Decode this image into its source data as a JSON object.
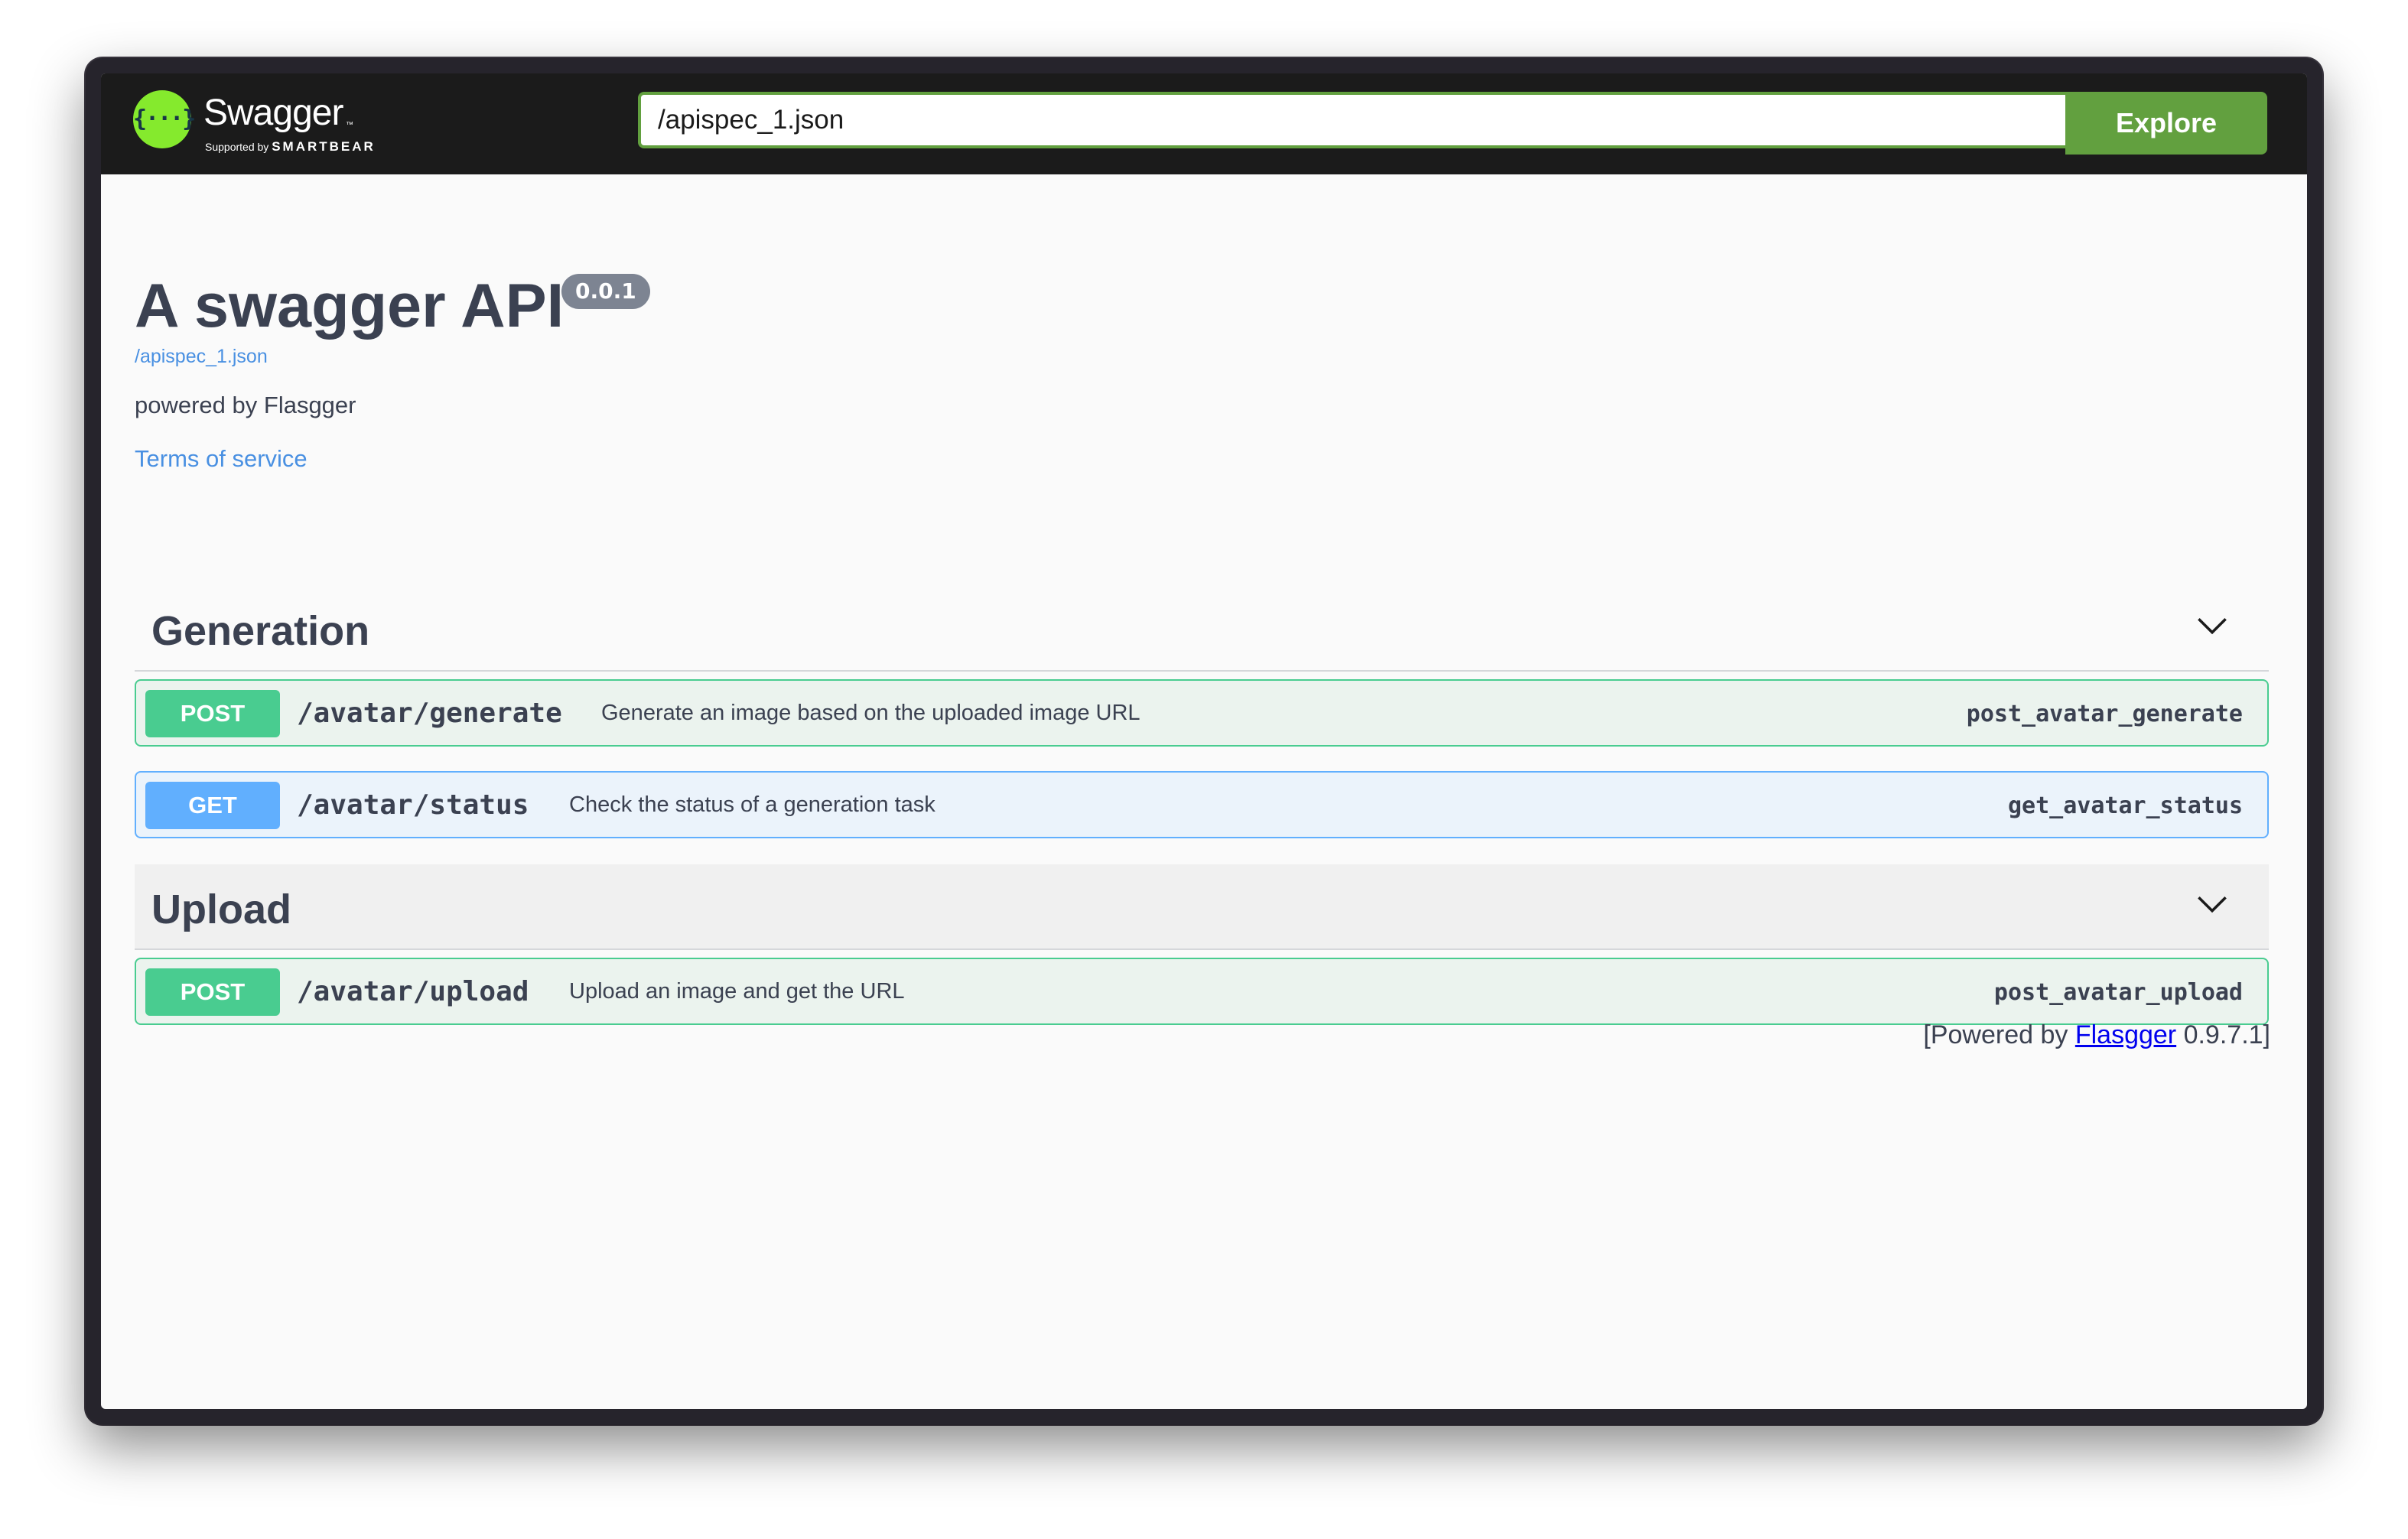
{
  "topbar": {
    "logo_name": "Swagger",
    "logo_tm": "™",
    "logo_sub_prefix": "Supported by",
    "logo_sub_brand": "SMARTBEAR",
    "url_value": "/apispec_1.json",
    "explore_label": "Explore"
  },
  "info": {
    "title": "A swagger API",
    "version": "0.0.1",
    "spec_link": "/apispec_1.json",
    "description": "powered by Flasgger",
    "terms_link": "Terms of service"
  },
  "tags": [
    {
      "name": "Generation",
      "operations": [
        {
          "method": "POST",
          "path": "/avatar/generate",
          "summary": "Generate an image based on the uploaded image URL",
          "operation_id": "post_avatar_generate"
        },
        {
          "method": "GET",
          "path": "/avatar/status",
          "summary": "Check the status of a generation task",
          "operation_id": "get_avatar_status"
        }
      ]
    },
    {
      "name": "Upload",
      "operations": [
        {
          "method": "POST",
          "path": "/avatar/upload",
          "summary": "Upload an image and get the URL",
          "operation_id": "post_avatar_upload"
        }
      ]
    }
  ],
  "footer": {
    "prefix": "[Powered by ",
    "link": "Flasgger",
    "suffix": " 0.9.7.1]"
  },
  "colors": {
    "topbar": "#1b1b1b",
    "accent_green": "#62a03f",
    "post": "#49cc90",
    "get": "#61affe",
    "text": "#3b4151",
    "link": "#4990e2"
  },
  "icons": {
    "logo": "swagger-logo-icon",
    "collapse": "chevron-down-icon"
  }
}
